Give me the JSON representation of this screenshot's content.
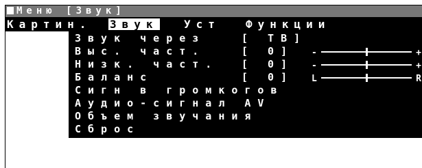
{
  "title": "Меню [Звук]",
  "menu": [
    "Картин.",
    "Звук",
    "Уст",
    "Функции"
  ],
  "active_menu": "Звук",
  "items": [
    {
      "label": "Звук через",
      "value": "[ ТВ]"
    },
    {
      "label": "Выс. част.",
      "value": "[  0]",
      "slider": {
        "left": "-",
        "right": "+",
        "level": 0.5
      }
    },
    {
      "label": "Низк. част.",
      "value": "[  0]",
      "slider": {
        "left": "-",
        "right": "+",
        "level": 0.5
      }
    },
    {
      "label": "Баланс",
      "value": "[  0]",
      "slider": {
        "left": "L",
        "right": "R",
        "level": 0.5
      }
    },
    {
      "label": "Сигн в громкогов"
    },
    {
      "label": "Аудио-сигнал AV"
    },
    {
      "label": "Объем звучания"
    },
    {
      "label": "Сброс"
    }
  ]
}
